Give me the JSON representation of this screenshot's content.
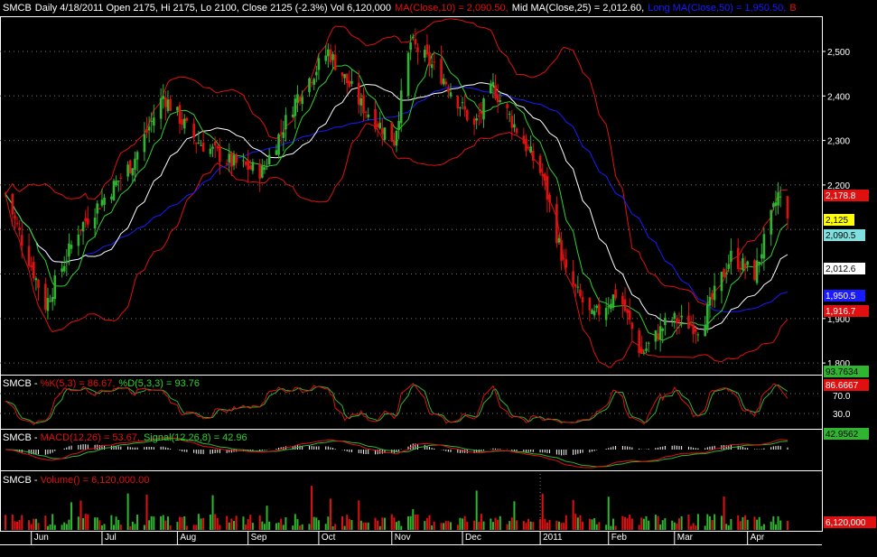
{
  "header": {
    "symbol": "SMCB",
    "summary": "Daily 4/18/2011 Open 2175, Hi 2175, Lo 2100, Close 2125 (-2.3%) Vol 6,120,000",
    "ma10": "MA(Close,10) = 2,090.50,",
    "mid_ma": "Mid MA(Close,25) = 2,012.60,",
    "long_ma": "Long MA(Close,50) = 1,950.50,",
    "tail": "B"
  },
  "stoch_header": {
    "symbol": "SMCB",
    "k": "%K(5,3) = 86.67,",
    "d": "%D(5,3,3) = 93.76"
  },
  "macd_header": {
    "symbol": "SMCB",
    "macd": "MACD(12,26) = 53.67,",
    "signal": "Signal(12,26,8) = 42.96"
  },
  "volume_header": {
    "symbol": "SMCB",
    "vol": "Volume() = 6,120,000.00"
  },
  "colors": {
    "up": "#2fb52f",
    "down": "#e01010",
    "band": "#e01010",
    "ma10": "#2fd12f",
    "mid": "#ffffff",
    "long": "#1a1aff",
    "grid": "#777777",
    "axis": "#ffffff"
  },
  "badges": {
    "upper_band": "2,178.8",
    "close": "2,125",
    "ma10": "2,090.5",
    "mid": "2,012.6",
    "long": "1,950.5",
    "lower_band": "1,916.7",
    "stoch_d": "93.7634",
    "stoch_k": "86.6667",
    "macd_signal": "42.9562",
    "volume": "6,120,000"
  },
  "chart_data": [
    {
      "type": "candlestick",
      "title": "SMCB Daily",
      "x_labels": [
        "Jun",
        "Jul",
        "Aug",
        "Sep",
        "Oct",
        "Nov",
        "Dec",
        "2011",
        "Feb",
        "Mar",
        "Apr"
      ],
      "y_ticks": [
        "2,500",
        "2,400",
        "2,300",
        "2,200",
        "1,900",
        "1,800"
      ],
      "ylim": [
        1780,
        2575
      ],
      "key_points": [
        {
          "date": "2010-05-21",
          "close": 2180
        },
        {
          "date": "2010-06-07",
          "close": 1930
        },
        {
          "date": "2010-06-21",
          "close": 2100
        },
        {
          "date": "2010-07-14",
          "close": 2250
        },
        {
          "date": "2010-07-27",
          "close": 2400
        },
        {
          "date": "2010-08-10",
          "close": 2300
        },
        {
          "date": "2010-08-25",
          "close": 2250
        },
        {
          "date": "2010-09-07",
          "close": 2230
        },
        {
          "date": "2010-09-22",
          "close": 2400
        },
        {
          "date": "2010-10-05",
          "close": 2500
        },
        {
          "date": "2010-10-19",
          "close": 2380
        },
        {
          "date": "2010-11-02",
          "close": 2300
        },
        {
          "date": "2010-11-09",
          "close": 2520
        },
        {
          "date": "2010-11-23",
          "close": 2440
        },
        {
          "date": "2010-12-06",
          "close": 2330
        },
        {
          "date": "2010-12-14",
          "close": 2420
        },
        {
          "date": "2011-01-04",
          "close": 2220
        },
        {
          "date": "2011-01-14",
          "close": 2000
        },
        {
          "date": "2011-01-25",
          "close": 1900
        },
        {
          "date": "2011-02-05",
          "close": 1960
        },
        {
          "date": "2011-02-15",
          "close": 1820
        },
        {
          "date": "2011-02-27",
          "close": 1900
        },
        {
          "date": "2011-03-12",
          "close": 1880
        },
        {
          "date": "2011-03-25",
          "close": 2040
        },
        {
          "date": "2011-04-04",
          "close": 2000
        },
        {
          "date": "2011-04-14",
          "close": 2178
        },
        {
          "date": "2011-04-18",
          "close": 2125
        }
      ],
      "last": {
        "open": 2175,
        "high": 2175,
        "low": 2100,
        "close": 2125,
        "volume": 6120000
      },
      "series": [
        {
          "name": "MA(Close,10)",
          "last": 2090.5
        },
        {
          "name": "Mid MA(Close,25)",
          "last": 2012.6
        },
        {
          "name": "Long MA(Close,50)",
          "last": 1950.5
        }
      ],
      "bands": {
        "upper_last": 2178.8,
        "lower_last": 1916.7
      }
    },
    {
      "type": "line",
      "title": "SMCB - %K(5,3) = 86.67, %D(5,3,3) = 93.76",
      "y_ticks": [
        "70.0",
        "30.0"
      ],
      "ylim": [
        0,
        100
      ],
      "series": [
        {
          "name": "%K(5,3)",
          "last": 86.67
        },
        {
          "name": "%D(5,3,3)",
          "last": 93.76
        }
      ]
    },
    {
      "type": "line",
      "title": "SMCB - MACD(12,26) = 53.67, Signal(12,26,8) = 42.96",
      "series": [
        {
          "name": "MACD(12,26)",
          "last": 53.67
        },
        {
          "name": "Signal(12,26,8)",
          "last": 42.96
        }
      ]
    },
    {
      "type": "bar",
      "title": "SMCB - Volume() = 6,120,000.00",
      "series": [
        {
          "name": "Volume()",
          "last": 6120000
        }
      ]
    }
  ]
}
